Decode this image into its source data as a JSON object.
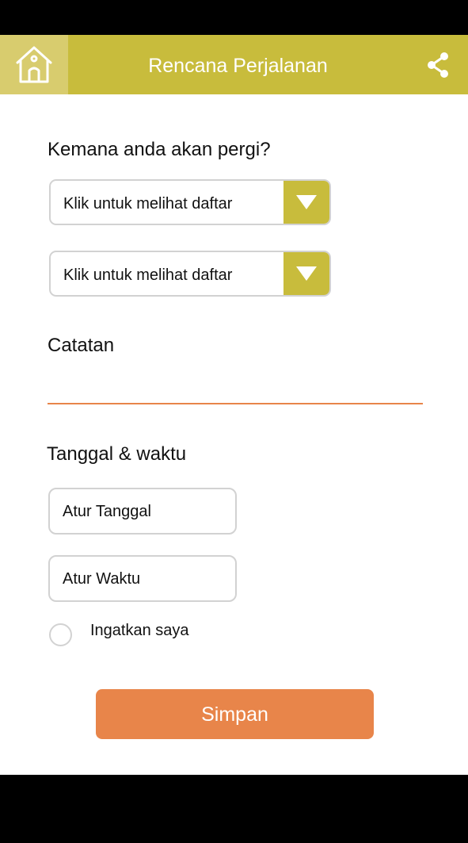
{
  "appbar": {
    "title": "Rencana Perjalanan",
    "home_icon": "home-icon",
    "share_icon": "share-icon",
    "color": "#c8bc3c"
  },
  "destination": {
    "label": "Kemana anda akan pergi?",
    "dropdowns": [
      {
        "value": "Klik untuk melihat daftar"
      },
      {
        "value": "Klik untuk melihat daftar"
      }
    ]
  },
  "notes": {
    "label": "Catatan",
    "value": ""
  },
  "datetime": {
    "label": "Tanggal & waktu",
    "date_button": "Atur Tanggal",
    "time_button": "Atur Waktu"
  },
  "reminder": {
    "label": "Ingatkan saya",
    "checked": false
  },
  "save_label": "Simpan",
  "colors": {
    "accent": "#c8bc3c",
    "accent_light": "#d8cc6e",
    "action": "#e8854a"
  }
}
